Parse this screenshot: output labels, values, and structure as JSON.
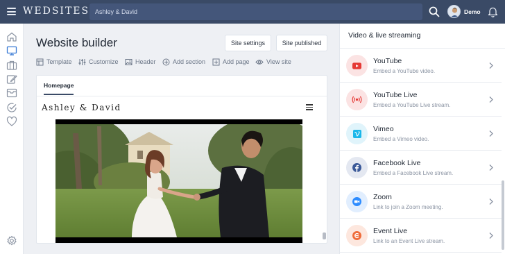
{
  "topbar": {
    "brand": "WEDSITES",
    "site_name": "Ashley & David",
    "user_name": "Demo"
  },
  "main": {
    "title": "Website builder",
    "site_settings_label": "Site settings",
    "site_published_label": "Site published",
    "toolbar": [
      {
        "label": "Template",
        "icon": "template-icon"
      },
      {
        "label": "Customize",
        "icon": "sliders-icon"
      },
      {
        "label": "Header",
        "icon": "image-icon"
      },
      {
        "label": "Add section",
        "icon": "plus-circle-icon"
      },
      {
        "label": "Add page",
        "icon": "add-page-icon"
      },
      {
        "label": "View site",
        "icon": "eye-icon"
      }
    ],
    "tab": "Homepage",
    "preview_logo": "Ashley & David"
  },
  "panel": {
    "title": "Video & live streaming",
    "items": [
      {
        "title": "YouTube",
        "desc": "Embed a YouTube video.",
        "icon": "youtube-icon",
        "color": "#e53935",
        "bg": "#fbe3e3"
      },
      {
        "title": "YouTube Live",
        "desc": "Embed a YouTube Live stream.",
        "icon": "live-broadcast-icon",
        "color": "#e53935",
        "bg": "#fbe3e3"
      },
      {
        "title": "Vimeo",
        "desc": "Embed a Vimeo video.",
        "icon": "vimeo-icon",
        "color": "#1ab7ea",
        "bg": "#e0f4fb"
      },
      {
        "title": "Facebook Live",
        "desc": "Embed a Facebook Live stream.",
        "icon": "facebook-icon",
        "color": "#3b5998",
        "bg": "#e4e8f1"
      },
      {
        "title": "Zoom",
        "desc": "Link to join a Zoom meeting.",
        "icon": "zoom-icon",
        "color": "#2d8cff",
        "bg": "#e1eefe"
      },
      {
        "title": "Event Live",
        "desc": "Link to an Event Live stream.",
        "icon": "eventlive-icon",
        "color": "#ef6c3a",
        "bg": "#fde7de"
      }
    ]
  }
}
